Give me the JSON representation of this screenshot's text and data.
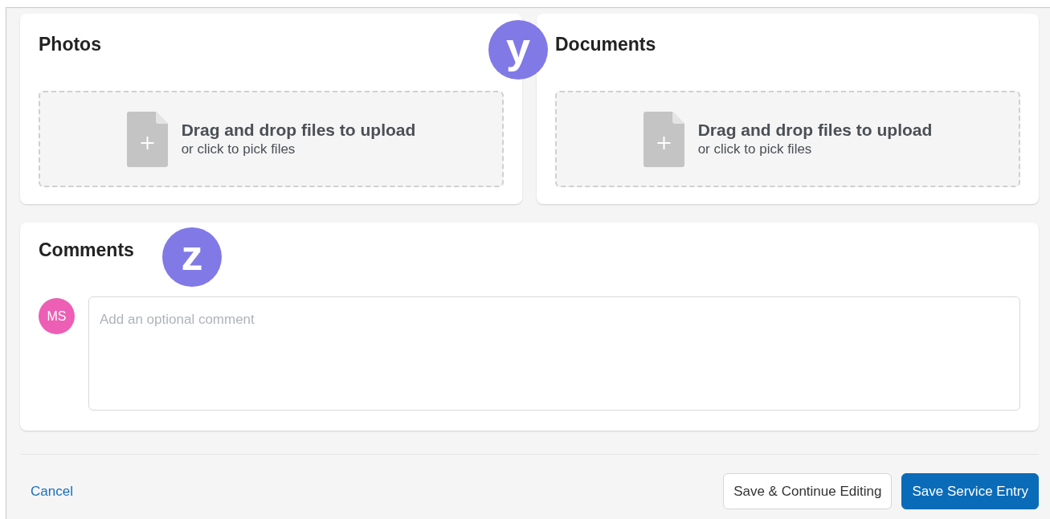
{
  "upload_cards": [
    {
      "title": "Photos",
      "dropzone": {
        "headline": "Drag and drop files to upload",
        "subtext": "or click to pick files"
      }
    },
    {
      "title": "Documents",
      "dropzone": {
        "headline": "Drag and drop files to upload",
        "subtext": "or click to pick files"
      }
    }
  ],
  "comments": {
    "title": "Comments",
    "avatar": {
      "initials": "MS",
      "color": "#ec5fb4"
    },
    "placeholder": "Add an optional comment"
  },
  "footer": {
    "cancel": "Cancel",
    "buttons": [
      {
        "label": "Save & Continue Editing",
        "kind": "secondary"
      },
      {
        "label": "Save Service Entry",
        "kind": "primary"
      }
    ]
  },
  "markers": [
    {
      "label": "y"
    },
    {
      "label": "z"
    }
  ]
}
